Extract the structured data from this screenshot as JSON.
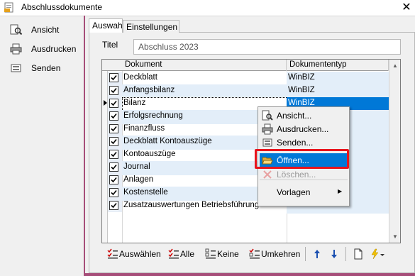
{
  "window": {
    "title": "Abschlussdokumente",
    "close_glyph": "✕"
  },
  "sidebar": {
    "items": [
      {
        "label": "Ansicht",
        "icon": "preview-icon"
      },
      {
        "label": "Ausdrucken",
        "icon": "printer-icon"
      },
      {
        "label": "Senden",
        "icon": "send-icon"
      }
    ]
  },
  "tabs": [
    {
      "label": "Auswahl",
      "active": true
    },
    {
      "label": "Einstellungen",
      "active": false
    }
  ],
  "form": {
    "titel_label": "Titel",
    "titel_value": "Abschluss 2023"
  },
  "grid": {
    "columns": [
      "Dokument",
      "Dokumententyp"
    ],
    "rows": [
      {
        "dokument": "Deckblatt",
        "typ": "WinBIZ",
        "checked": true
      },
      {
        "dokument": "Anfangsbilanz",
        "typ": "WinBIZ",
        "checked": true
      },
      {
        "dokument": "Bilanz",
        "typ": "WinBIZ",
        "checked": true,
        "selected": true
      },
      {
        "dokument": "Erfolgsrechnung",
        "typ": "",
        "checked": true
      },
      {
        "dokument": "Finanzfluss",
        "typ": "",
        "checked": true
      },
      {
        "dokument": "Deckblatt Kontoauszüge",
        "typ": "",
        "checked": true
      },
      {
        "dokument": "Kontoauszüge",
        "typ": "",
        "checked": true
      },
      {
        "dokument": "Journal",
        "typ": "",
        "checked": true
      },
      {
        "dokument": "Anlagen",
        "typ": "",
        "checked": true
      },
      {
        "dokument": "Kostenstelle",
        "typ": "",
        "checked": true
      },
      {
        "dokument": "Zusatzauswertungen Betriebsführung",
        "typ": "",
        "checked": true
      }
    ]
  },
  "toolbar": {
    "select_label": "Auswählen",
    "all_label": "Alle",
    "none_label": "Keine",
    "invert_label": "Umkehren"
  },
  "context_menu": {
    "items": [
      {
        "label": "Ansicht...",
        "enabled": true
      },
      {
        "label": "Ausdrucken...",
        "enabled": true
      },
      {
        "label": "Senden...",
        "enabled": true
      },
      {
        "label": "Öffnen...",
        "enabled": true,
        "highlighted": true
      },
      {
        "label": "Löschen...",
        "enabled": false
      },
      {
        "label": "Vorlagen",
        "enabled": true,
        "submenu_arrow": "▶"
      }
    ]
  },
  "colors": {
    "accent": "#0078d7",
    "frame_border": "#a64d79",
    "highlight_box": "#e8141c",
    "row_tint": "#e3eef9"
  }
}
